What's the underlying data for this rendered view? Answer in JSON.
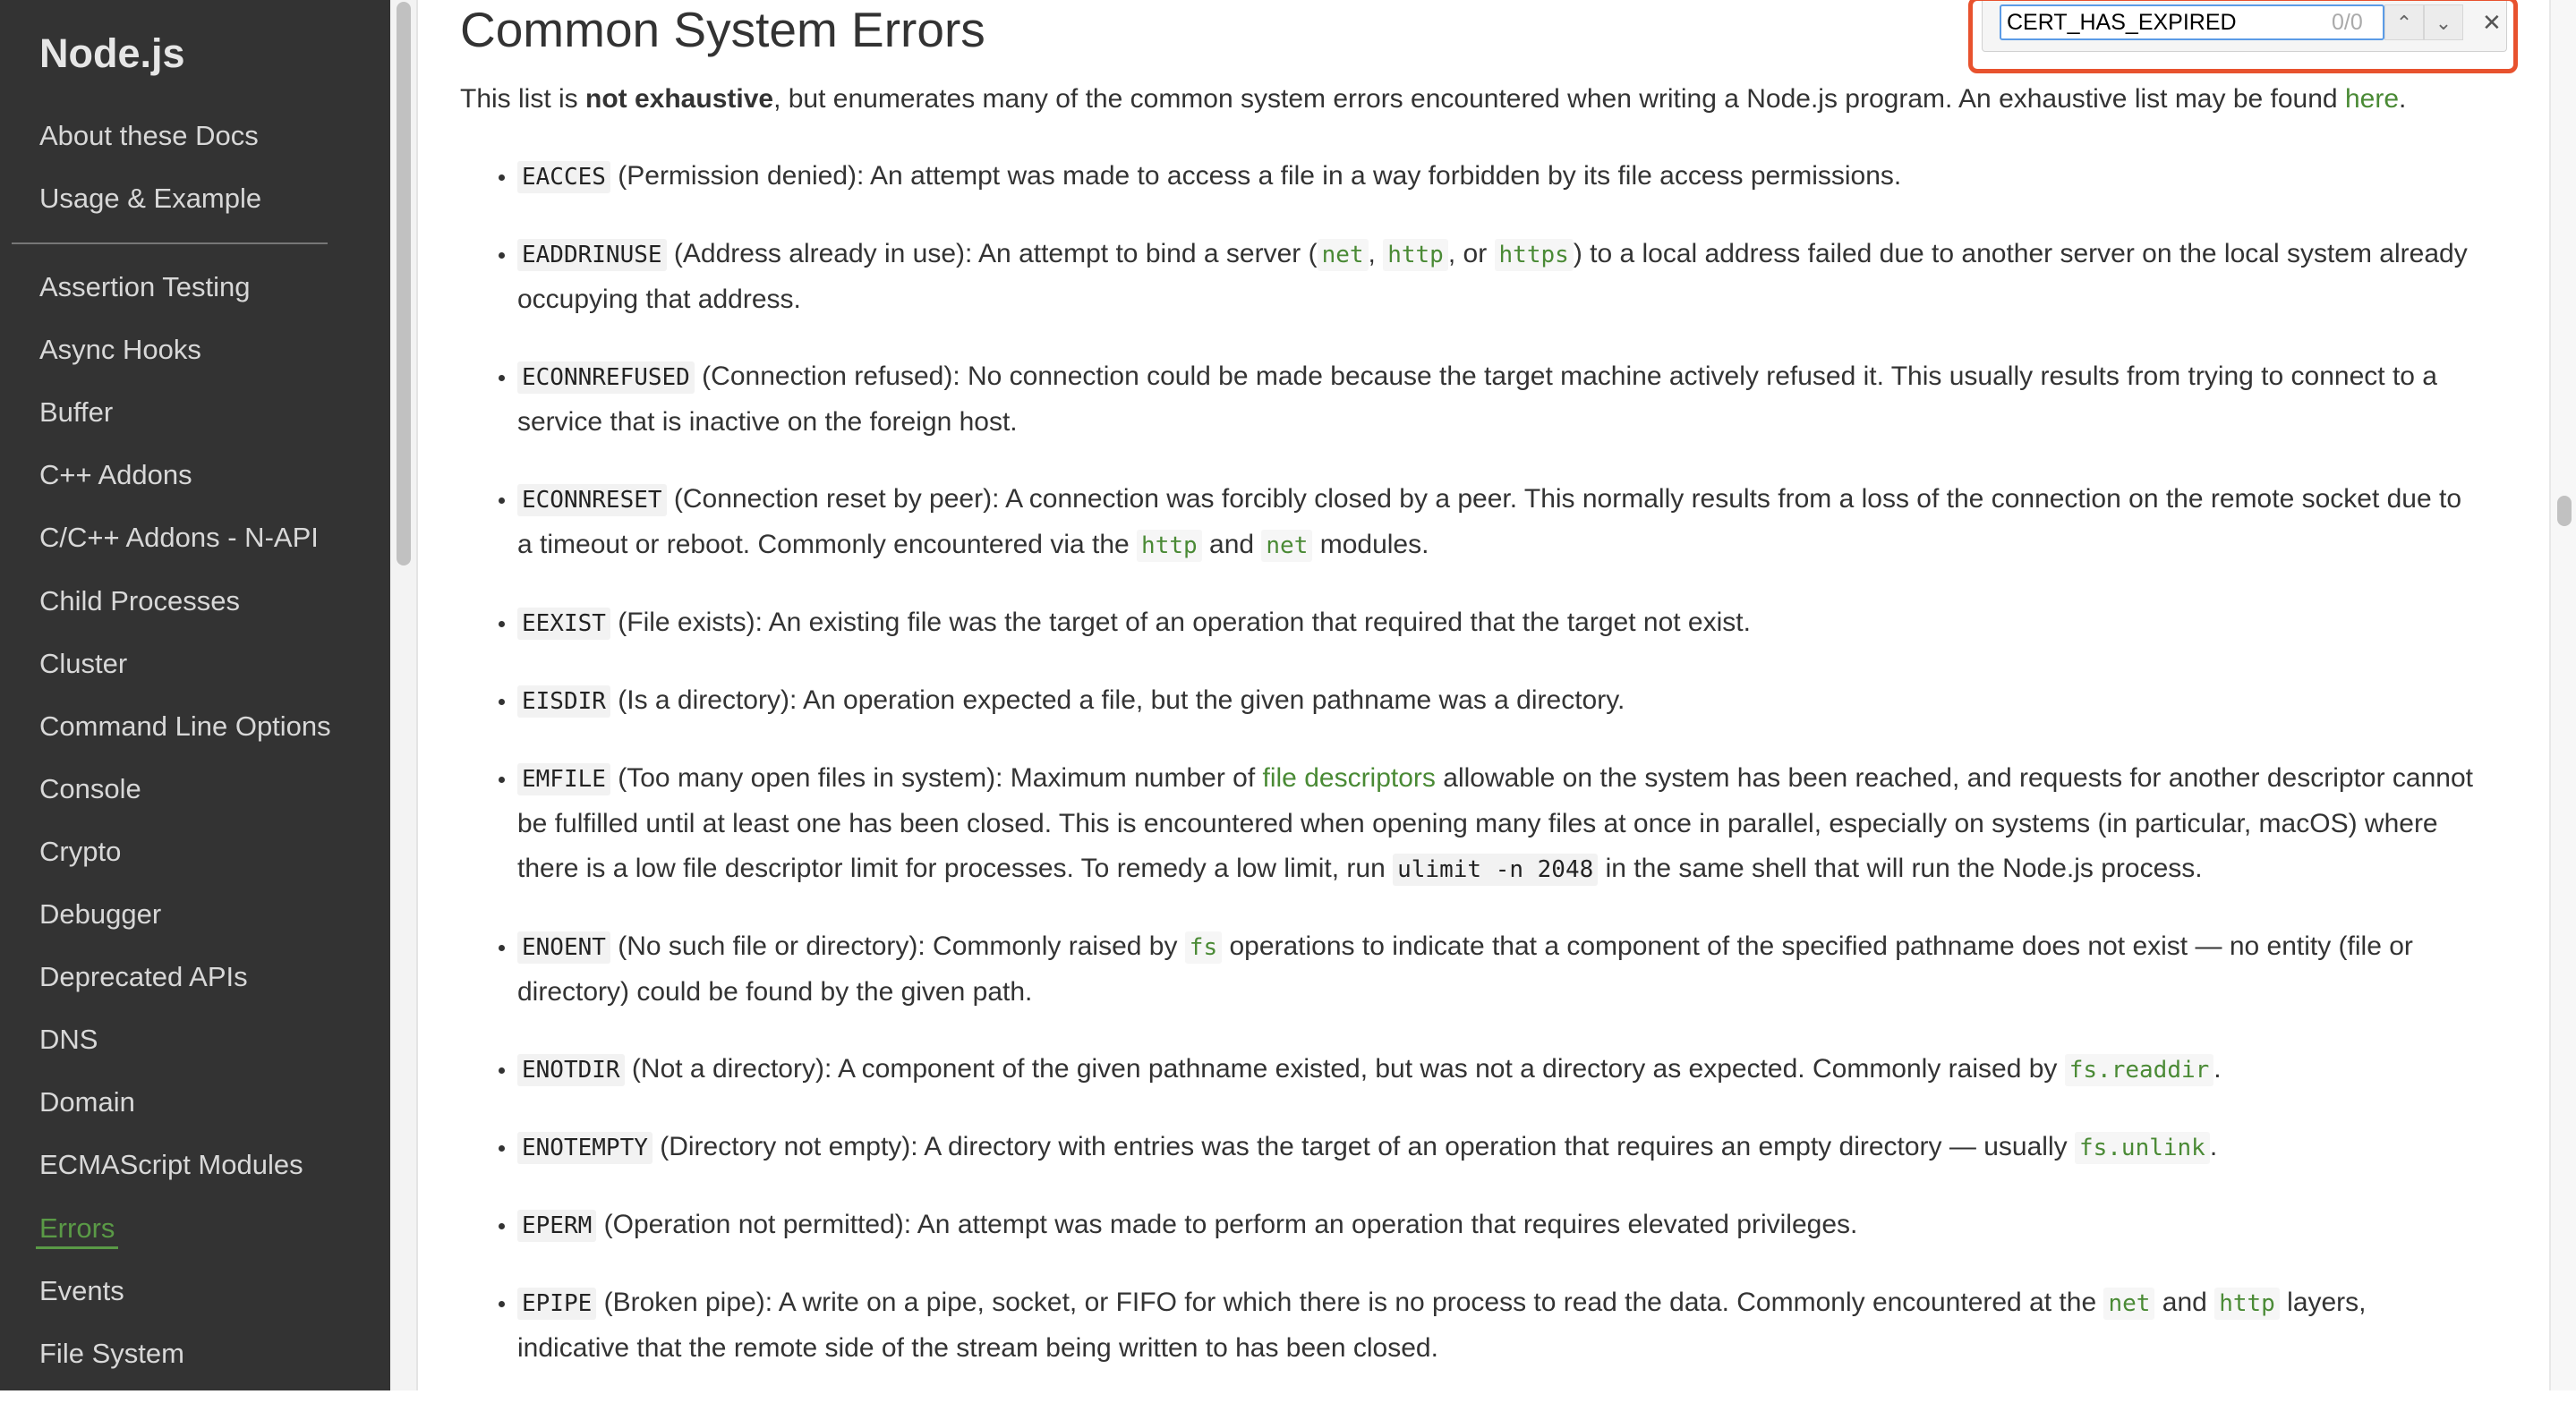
{
  "sidebar": {
    "brand": "Node.js",
    "top_items": [
      "About these Docs",
      "Usage & Example"
    ],
    "items": [
      "Assertion Testing",
      "Async Hooks",
      "Buffer",
      "C++ Addons",
      "C/C++ Addons - N-API",
      "Child Processes",
      "Cluster",
      "Command Line Options",
      "Console",
      "Crypto",
      "Debugger",
      "Deprecated APIs",
      "DNS",
      "Domain",
      "ECMAScript Modules",
      "Errors",
      "Events",
      "File System"
    ],
    "active": "Errors",
    "accent_color": "#5a9a46"
  },
  "find_bar": {
    "query": "CERT_HAS_EXPIRED",
    "count": "0/0",
    "prev_icon": "chevron-up-icon",
    "next_icon": "chevron-down-icon",
    "close_icon": "close-icon",
    "highlight_color": "#e8522e"
  },
  "main": {
    "title": "Common System Errors",
    "intro": {
      "before": "This list is ",
      "bold": "not exhaustive",
      "after": ", but enumerates many of the common system errors encountered when writing a Node.js program. An exhaustive list may be found ",
      "link": "here",
      "end": "."
    },
    "errors": [
      {
        "code": "EACCES",
        "parts": [
          [
            "t",
            " (Permission denied): An attempt was made to access a file in a way forbidden by its file access permissions."
          ]
        ]
      },
      {
        "code": "EADDRINUSE",
        "parts": [
          [
            "t",
            " (Address already in use): An attempt to bind a server ("
          ],
          [
            "lc",
            "net"
          ],
          [
            "t",
            ", "
          ],
          [
            "lc",
            "http"
          ],
          [
            "t",
            ", or "
          ],
          [
            "lc",
            "https"
          ],
          [
            "t",
            ") to a local address failed due to another server on the local system already occupying that address."
          ]
        ]
      },
      {
        "code": "ECONNREFUSED",
        "parts": [
          [
            "t",
            " (Connection refused): No connection could be made because the target machine actively refused it. This usually results from trying to connect to a service that is inactive on the foreign host."
          ]
        ]
      },
      {
        "code": "ECONNRESET",
        "parts": [
          [
            "t",
            " (Connection reset by peer): A connection was forcibly closed by a peer. This normally results from a loss of the connection on the remote socket due to a timeout or reboot. Commonly encountered via the "
          ],
          [
            "lc",
            "http"
          ],
          [
            "t",
            " and "
          ],
          [
            "lc",
            "net"
          ],
          [
            "t",
            " modules."
          ]
        ]
      },
      {
        "code": "EEXIST",
        "parts": [
          [
            "t",
            " (File exists): An existing file was the target of an operation that required that the target not exist."
          ]
        ]
      },
      {
        "code": "EISDIR",
        "parts": [
          [
            "t",
            " (Is a directory): An operation expected a file, but the given pathname was a directory."
          ]
        ]
      },
      {
        "code": "EMFILE",
        "parts": [
          [
            "t",
            " (Too many open files in system): Maximum number of "
          ],
          [
            "l",
            "file descriptors"
          ],
          [
            "t",
            " allowable on the system has been reached, and requests for another descriptor cannot be fulfilled until at least one has been closed. This is encountered when opening many files at once in parallel, especially on systems (in particular, macOS) where there is a low file descriptor limit for processes. To remedy a low limit, run "
          ],
          [
            "c",
            "ulimit -n 2048"
          ],
          [
            "t",
            " in the same shell that will run the Node.js process."
          ]
        ]
      },
      {
        "code": "ENOENT",
        "parts": [
          [
            "t",
            " (No such file or directory): Commonly raised by "
          ],
          [
            "lc",
            "fs"
          ],
          [
            "t",
            " operations to indicate that a component of the specified pathname does not exist — no entity (file or directory) could be found by the given path."
          ]
        ]
      },
      {
        "code": "ENOTDIR",
        "parts": [
          [
            "t",
            " (Not a directory): A component of the given pathname existed, but was not a directory as expected. Commonly raised by "
          ],
          [
            "lc",
            "fs.readdir"
          ],
          [
            "t",
            "."
          ]
        ]
      },
      {
        "code": "ENOTEMPTY",
        "parts": [
          [
            "t",
            " (Directory not empty): A directory with entries was the target of an operation that requires an empty directory — usually "
          ],
          [
            "lc",
            "fs.unlink"
          ],
          [
            "t",
            "."
          ]
        ]
      },
      {
        "code": "EPERM",
        "parts": [
          [
            "t",
            " (Operation not permitted): An attempt was made to perform an operation that requires elevated privileges."
          ]
        ]
      },
      {
        "code": "EPIPE",
        "parts": [
          [
            "t",
            " (Broken pipe): A write on a pipe, socket, or FIFO for which there is no process to read the data. Commonly encountered at the "
          ],
          [
            "lc",
            "net"
          ],
          [
            "t",
            " and "
          ],
          [
            "lc",
            "http"
          ],
          [
            "t",
            " layers, indicative that the remote side of the stream being written to has been closed."
          ]
        ]
      }
    ]
  }
}
